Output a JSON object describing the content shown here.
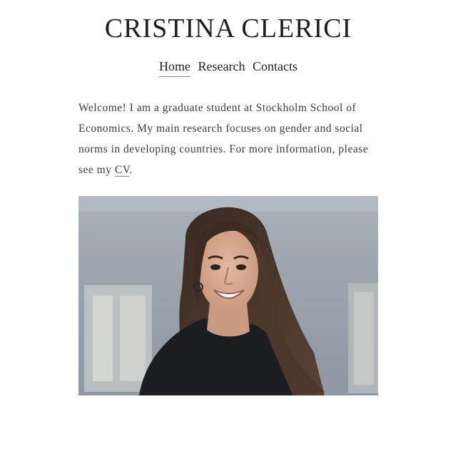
{
  "site": {
    "title": "CRISTINA CLERICI"
  },
  "nav": {
    "items": [
      {
        "label": "Home",
        "active": true
      },
      {
        "label": "Research",
        "active": false
      },
      {
        "label": "Contacts",
        "active": false
      }
    ]
  },
  "intro": {
    "text_before_link": "Welcome! I am a graduate student at Stockholm School of Economics. My main research focuses on gender and social norms in developing countries. For more information, please see my ",
    "link_label": "CV",
    "text_after_link": "."
  },
  "colors": {
    "background": "#ffffff",
    "text": "#1e1e1e",
    "body_text": "#3a3a3a",
    "photo_background": "#9aa3ad"
  },
  "photo": {
    "subject": "portrait-photo"
  }
}
